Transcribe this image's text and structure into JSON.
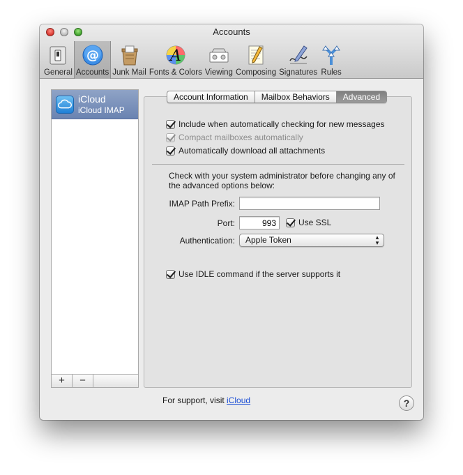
{
  "window": {
    "title": "Accounts"
  },
  "toolbar": {
    "items": [
      {
        "label": "General",
        "icon": "general-switch-icon"
      },
      {
        "label": "Accounts",
        "icon": "at-sign-icon",
        "selected": true
      },
      {
        "label": "Junk Mail",
        "icon": "junk-mail-icon"
      },
      {
        "label": "Fonts & Colors",
        "icon": "fonts-colors-icon"
      },
      {
        "label": "Viewing",
        "icon": "viewing-icon"
      },
      {
        "label": "Composing",
        "icon": "composing-icon"
      },
      {
        "label": "Signatures",
        "icon": "signatures-icon"
      },
      {
        "label": "Rules",
        "icon": "rules-icon"
      }
    ]
  },
  "sidebar": {
    "account": {
      "name": "iCloud",
      "type": "iCloud IMAP",
      "icon": "cloud-icon"
    },
    "add_label": "+",
    "remove_label": "−"
  },
  "tabs": {
    "items": [
      "Account Information",
      "Mailbox Behaviors",
      "Advanced"
    ],
    "active": "Advanced"
  },
  "advanced": {
    "include_checking": {
      "label": "Include when automatically checking for new messages",
      "checked": true
    },
    "compact_mailboxes": {
      "label": "Compact mailboxes automatically",
      "checked": true,
      "disabled": true
    },
    "download_attachments": {
      "label": "Automatically download all attachments",
      "checked": true
    },
    "note": "Check with your system administrator before changing any of the advanced options below:",
    "imap_prefix": {
      "label": "IMAP Path Prefix:",
      "value": ""
    },
    "port": {
      "label": "Port:",
      "value": "993"
    },
    "use_ssl": {
      "label": "Use SSL",
      "checked": true
    },
    "authentication": {
      "label": "Authentication:",
      "value": "Apple Token"
    },
    "use_idle": {
      "label": "Use IDLE command if the server supports it",
      "checked": true
    }
  },
  "footer": {
    "support_text": "For support, visit",
    "support_link": "iCloud",
    "help_label": "?"
  },
  "colors": {
    "selection": "#7a90bb",
    "link": "#1c4fd6",
    "tab_active": "#8c8c8c"
  }
}
